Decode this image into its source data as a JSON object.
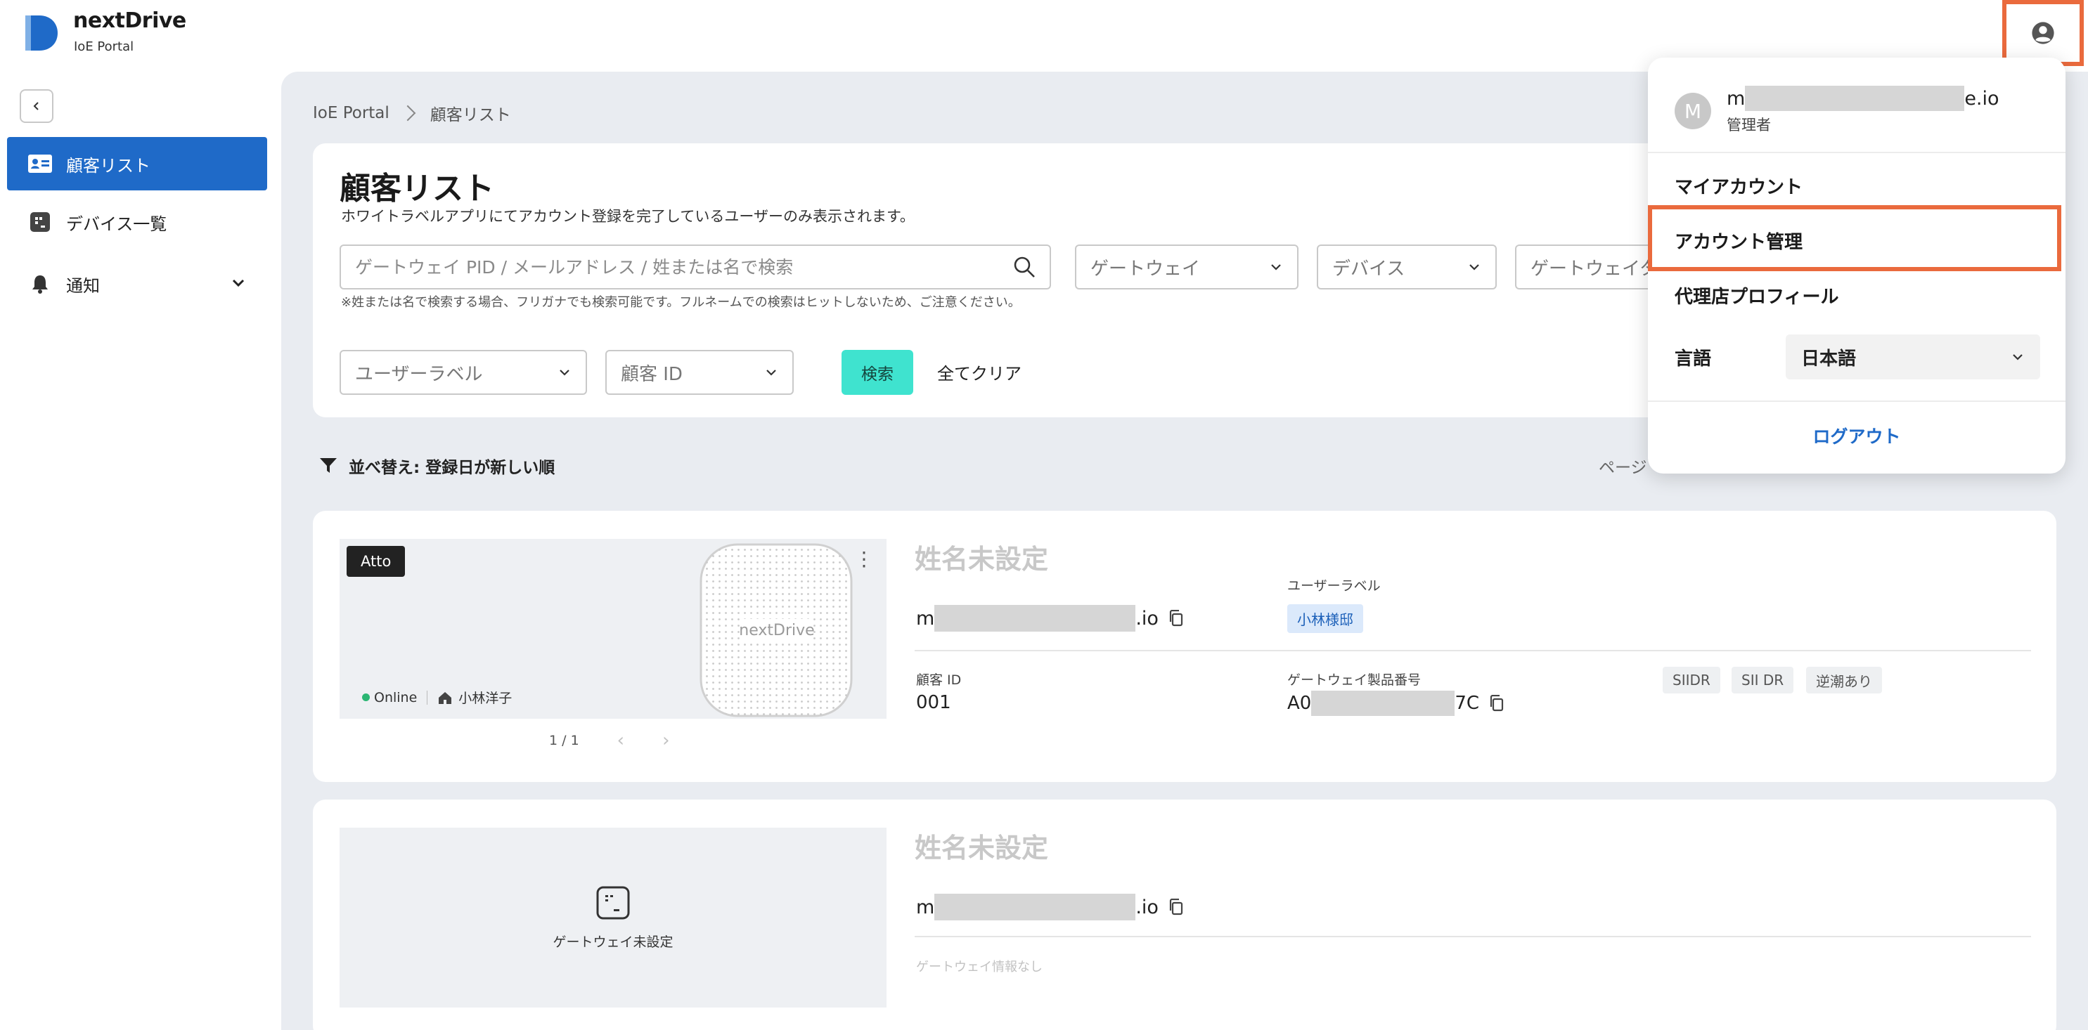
{
  "brand": {
    "name": "nextDrive",
    "subtitle": "IoE Portal",
    "accent": "#1f6ac8"
  },
  "sidebar": {
    "items": [
      {
        "label": "顧客リスト",
        "icon": "id-card-icon",
        "active": true
      },
      {
        "label": "デバイス一覧",
        "icon": "device-icon",
        "active": false
      },
      {
        "label": "通知",
        "icon": "bell-icon",
        "active": false,
        "expandable": true
      }
    ]
  },
  "breadcrumb": {
    "root": "IoE Portal",
    "current": "顧客リスト"
  },
  "filters": {
    "title": "顧客リスト",
    "description": "ホワイトラベルアプリにてアカウント登録を完了しているユーザーのみ表示されます。",
    "search_placeholder": "ゲートウェイ PID / メールアドレス / 姓または名で検索",
    "search_note": "※姓または名で検索する場合、フリガナでも検索可能です。フルネームでの検索はヒットしないため、ご注意ください。",
    "gateway_dd": "ゲートウェイ",
    "device_dd": "デバイス",
    "gateway_type_dd": "ゲートウェイタ",
    "user_label_dd": "ユーザーラベル",
    "customer_id_dd": "顧客 ID",
    "search_button": "検索",
    "clear_button": "全てクリア"
  },
  "sort": {
    "label": "並べ替え: 登録日が新しい順",
    "page_label": "ページ"
  },
  "customers": [
    {
      "name": "姓名未設定",
      "email_prefix": "m",
      "email_suffix": ".io",
      "model": "Atto",
      "device_brand": "nextDrive",
      "status": "Online",
      "home_name": "小林洋子",
      "pager": "1 / 1",
      "user_label_title": "ユーザーラベル",
      "user_label": "小林様邸",
      "customer_id_title": "顧客 ID",
      "customer_id": "001",
      "gateway_serial_title": "ゲートウェイ製品番号",
      "gateway_serial_prefix": "A0",
      "gateway_serial_suffix": "7C",
      "tags": [
        "SIIDR",
        "SII DR",
        "逆潮あり"
      ]
    },
    {
      "name": "姓名未設定",
      "email_prefix": "m",
      "email_suffix": ".io",
      "gateway_unset": "ゲートウェイ未設定",
      "gateway_none": "ゲートウェイ情報なし"
    }
  ],
  "user_menu": {
    "avatar_letter": "M",
    "email_prefix": "m",
    "email_suffix": "e.io",
    "role": "管理者",
    "items": [
      "マイアカウント",
      "アカウント管理",
      "代理店プロフィール"
    ],
    "language_label": "言語",
    "language_value": "日本語",
    "logout": "ログアウト",
    "highlight_color": "#ea6a3d"
  }
}
